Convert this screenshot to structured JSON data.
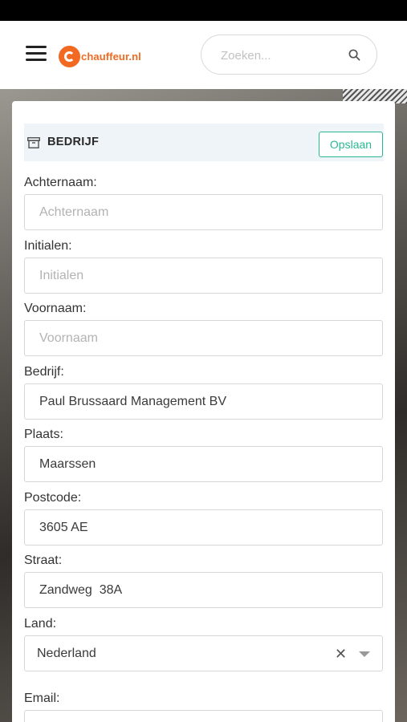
{
  "header": {
    "logo_text": "chauffeur.nl",
    "search_placeholder": "Zoeken..."
  },
  "card": {
    "title": "BEDRIJF",
    "save_label": "Opslaan"
  },
  "form": {
    "achternaam": {
      "label": "Achternaam:",
      "value": "",
      "placeholder": "Achternaam"
    },
    "initialen": {
      "label": "Initialen:",
      "value": "",
      "placeholder": "Initialen"
    },
    "voornaam": {
      "label": "Voornaam:",
      "value": "",
      "placeholder": "Voornaam"
    },
    "bedrijf": {
      "label": "Bedrijf:",
      "value": "Paul Brussaard Management BV",
      "placeholder": ""
    },
    "plaats": {
      "label": "Plaats:",
      "value": "Maarssen",
      "placeholder": ""
    },
    "postcode": {
      "label": "Postcode:",
      "value": "3605 AE",
      "placeholder": ""
    },
    "straat": {
      "label": "Straat:",
      "value": "Zandweg  38A",
      "placeholder": ""
    },
    "land": {
      "label": "Land:",
      "value": "Nederland",
      "clear_glyph": "✕"
    },
    "email": {
      "label": "Email:",
      "value": "",
      "placeholder": ""
    }
  },
  "colors": {
    "brand": "#f26a21",
    "accent": "#2bb892"
  },
  "icons": {
    "menu": "hamburger-icon",
    "search": "search-icon",
    "archive": "archive-icon"
  }
}
